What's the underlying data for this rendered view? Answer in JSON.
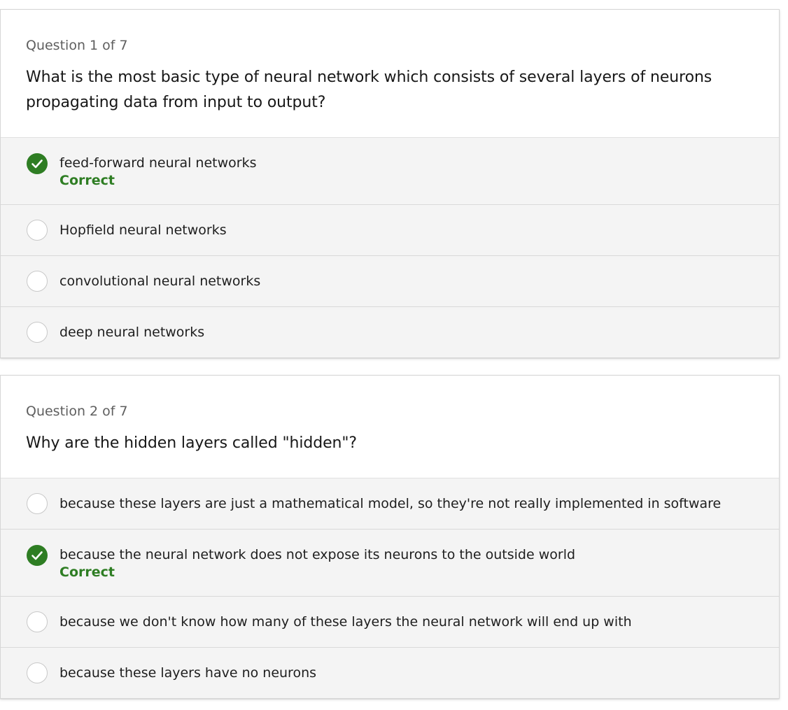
{
  "questions": [
    {
      "count_label": "Question 1 of 7",
      "text": "What is the most basic type of neural network which consists of several layers of neurons propagating data from input to output?",
      "options": [
        {
          "label": "feed-forward neural networks",
          "selected": true,
          "feedback": "Correct"
        },
        {
          "label": "Hopfield neural networks",
          "selected": false
        },
        {
          "label": "convolutional neural networks",
          "selected": false
        },
        {
          "label": "deep neural networks",
          "selected": false
        }
      ]
    },
    {
      "count_label": "Question 2 of 7",
      "text": "Why are the hidden layers called \"hidden\"?",
      "options": [
        {
          "label": "because these layers are just a mathematical model, so they're not really implemented in software",
          "selected": false
        },
        {
          "label": "because the neural network does not expose its neurons to the outside world",
          "selected": true,
          "feedback": "Correct"
        },
        {
          "label": "because we don't know how many of these layers the neural network will end up with",
          "selected": false
        },
        {
          "label": "because these layers have no neurons",
          "selected": false
        }
      ]
    }
  ],
  "icons": {
    "checked": "checkmark-icon",
    "unchecked": "radio-empty-icon"
  },
  "colors": {
    "correct": "#2e7d23",
    "option_bg": "#f4f4f4",
    "muted_text": "#5f5f5f"
  }
}
